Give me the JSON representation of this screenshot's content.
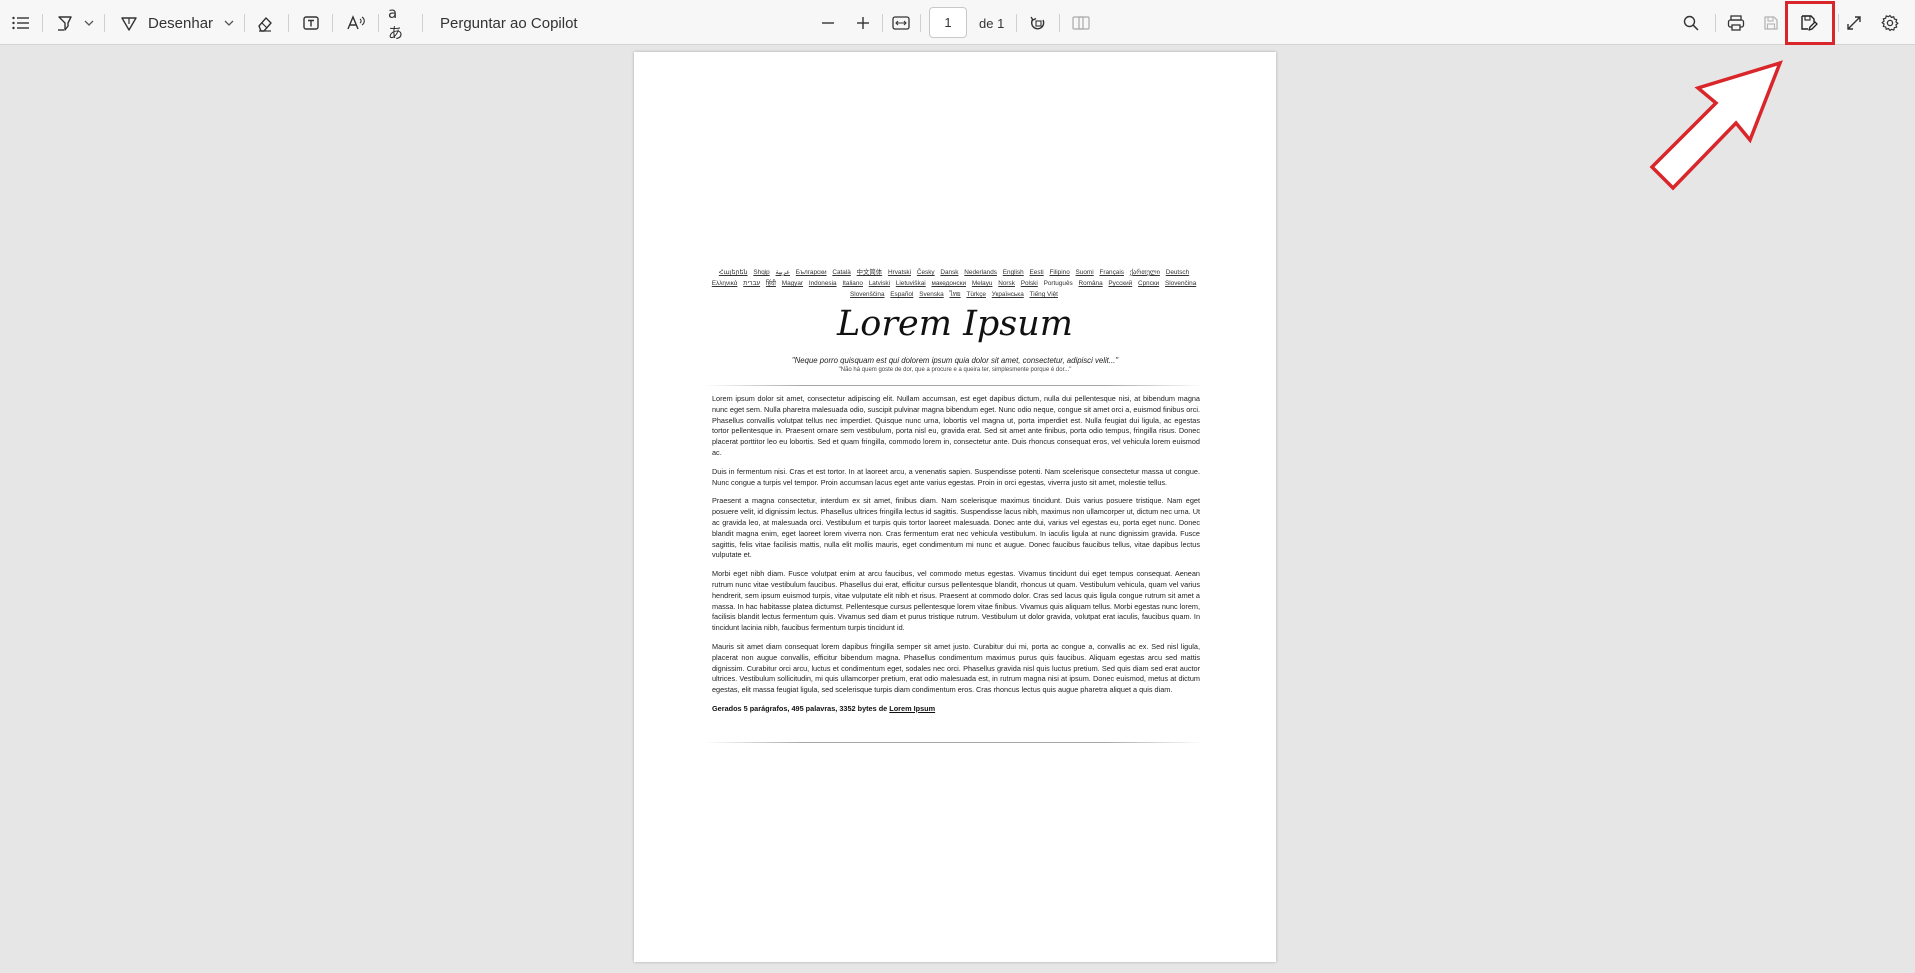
{
  "toolbar": {
    "draw_label": "Desenhar",
    "copilot_label": "Perguntar ao Copilot",
    "page_number": "1",
    "page_of": "de 1",
    "icons": [
      "contents-icon",
      "highlight-icon",
      "chevron-down-icon",
      "draw-icon",
      "eraser-icon",
      "text-box-icon",
      "read-aloud-icon",
      "translate-icon",
      "zoom-out-icon",
      "zoom-in-icon",
      "fit-page-icon",
      "rotate-icon",
      "page-view-icon",
      "search-icon",
      "print-icon",
      "save-icon",
      "save-as-icon",
      "fullscreen-icon",
      "settings-icon"
    ],
    "highlight_color": "#d9262b"
  },
  "document": {
    "languages": [
      "Հայերեն",
      "Shqip",
      "عربية",
      "Български",
      "Català",
      "中文简体",
      "Hrvatski",
      "Česky",
      "Dansk",
      "Nederlands",
      "English",
      "Eesti",
      "Filipino",
      "Suomi",
      "Français",
      "ქართული",
      "Deutsch",
      "Ελληνικά",
      "עברית",
      "हिंदी",
      "Magyar",
      "Indonesia",
      "Italiano",
      "Latviski",
      "Lietuviškai",
      "македонски",
      "Melayu",
      "Norsk",
      "Polski",
      "Português",
      "Româna",
      "Pyccкий",
      "Српски",
      "Slovenčina",
      "Slovenščina",
      "Español",
      "Svenska",
      "ไทย",
      "Türkçe",
      "Українська",
      "Tiếng Việt"
    ],
    "current_language": "Português",
    "title": "Lorem Ipsum",
    "quote": "\"Neque porro quisquam est qui dolorem ipsum quia dolor sit amet, consectetur, adipisci velit...\"",
    "quote_translation": "\"Não há quem goste de dor, que a procure e a queira ter, simplesmente porque é dor...\"",
    "paragraphs": [
      "Lorem ipsum dolor sit amet, consectetur adipiscing elit. Nullam accumsan, est eget dapibus dictum, nulla dui pellentesque nisi, at bibendum magna nunc eget sem. Nulla pharetra malesuada odio, suscipit pulvinar magna bibendum eget. Nunc odio neque, congue sit amet orci a, euismod finibus orci. Phasellus convallis volutpat tellus nec imperdiet. Quisque nunc urna, lobortis vel magna ut, porta imperdiet est. Nulla feugiat dui ligula, ac egestas tortor pellentesque in. Praesent ornare sem vestibulum, porta nisl eu, gravida erat. Sed sit amet ante finibus, porta odio tempus, fringilla risus. Donec placerat porttitor leo eu lobortis. Sed et quam fringilla, commodo lorem in, consectetur ante. Duis rhoncus consequat eros, vel vehicula lorem euismod ac.",
      "Duis in fermentum nisi. Cras et est tortor. In at laoreet arcu, a venenatis sapien. Suspendisse potenti. Nam scelerisque consectetur massa ut congue. Nunc congue a turpis vel tempor. Proin accumsan lacus eget ante varius egestas. Proin in orci egestas, viverra justo sit amet, molestie tellus.",
      "Praesent a magna consectetur, interdum ex sit amet, finibus diam. Nam scelerisque maximus tincidunt. Duis varius posuere tristique. Nam eget posuere velit, id dignissim lectus. Phasellus ultrices fringilla lectus id sagittis. Suspendisse lacus nibh, maximus non ullamcorper ut, dictum nec urna. Ut ac gravida leo, at malesuada orci. Vestibulum et turpis quis tortor laoreet malesuada. Donec ante dui, varius vel egestas eu, porta eget nunc. Donec blandit magna enim, eget laoreet lorem viverra non. Cras fermentum erat nec vehicula vestibulum. In iaculis ligula at nunc dignissim gravida. Fusce sagittis, felis vitae facilisis mattis, nulla elit mollis mauris, eget condimentum mi nunc et augue. Donec faucibus faucibus tellus, vitae dapibus lectus vulputate et.",
      "Morbi eget nibh diam. Fusce volutpat enim at arcu faucibus, vel commodo metus egestas. Vivamus tincidunt dui eget tempus consequat. Aenean rutrum nunc vitae vestibulum faucibus. Phasellus dui erat, efficitur cursus pellentesque blandit, rhoncus ut quam. Vestibulum vehicula, quam vel varius hendrerit, sem ipsum euismod turpis, vitae vulputate elit nibh et risus. Praesent at commodo dolor. Cras sed lacus quis ligula congue rutrum sit amet a massa. In hac habitasse platea dictumst. Pellentesque cursus pellentesque lorem vitae finibus. Vivamus quis aliquam tellus. Morbi egestas nunc lorem, facilisis blandit lectus fermentum quis. Vivamus sed diam et purus tristique rutrum. Vestibulum ut dolor gravida, volutpat erat iaculis, faucibus quam. In tincidunt lacinia nibh, faucibus fermentum turpis tincidunt id.",
      "Mauris sit amet diam consequat lorem dapibus fringilla semper sit amet justo. Curabitur dui mi, porta ac congue a, convallis ac ex. Sed nisl ligula, placerat non augue convallis, efficitur bibendum magna. Phasellus condimentum maximus purus quis faucibus. Aliquam egestas arcu sed mattis dignissim. Curabitur orci arcu, luctus et condimentum eget, sodales nec orci. Phasellus gravida nisl quis luctus pretium. Sed quis diam sed erat auctor ultrices. Vestibulum sollicitudin, mi quis ullamcorper pretium, erat odio malesuada est, in rutrum magna nisi at ipsum. Donec euismod, metus at dictum egestas, elit massa feugiat ligula, sed scelerisque turpis diam condimentum eros. Cras rhoncus lectus quis augue pharetra aliquet a quis diam."
    ],
    "footer_prefix": "Gerados 5 parágrafos, 495 palavras, 3352 bytes de",
    "footer_link": "Lorem Ipsum"
  }
}
